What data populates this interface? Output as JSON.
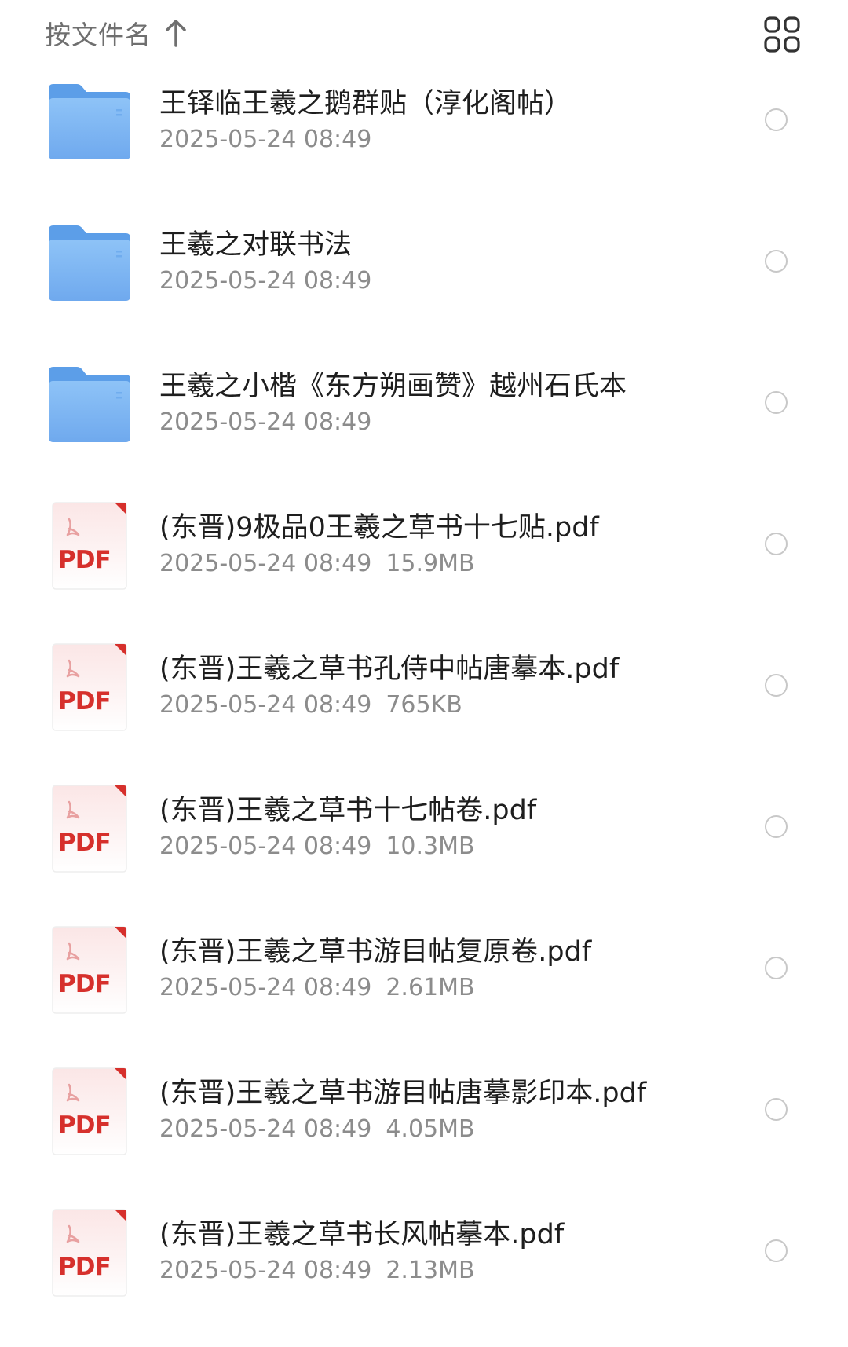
{
  "header": {
    "sort_label": "按文件名",
    "sort_icon": "arrow-up-icon",
    "view_icon": "grid-view-icon"
  },
  "files": [
    {
      "type": "folder",
      "name": "王铎临王羲之鹅群贴（淳化阁帖）",
      "date": "2025-05-24 08:49",
      "size": ""
    },
    {
      "type": "folder",
      "name": "王羲之对联书法",
      "date": "2025-05-24 08:49",
      "size": ""
    },
    {
      "type": "folder",
      "name": "王羲之小楷《东方朔画赞》越州石氏本",
      "date": "2025-05-24 08:49",
      "size": ""
    },
    {
      "type": "pdf",
      "name": "(东晋)9极品0王羲之草书十七贴.pdf",
      "date": "2025-05-24 08:49",
      "size": "15.9MB"
    },
    {
      "type": "pdf",
      "name": "(东晋)王羲之草书孔侍中帖唐摹本.pdf",
      "date": "2025-05-24 08:49",
      "size": "765KB"
    },
    {
      "type": "pdf",
      "name": "(东晋)王羲之草书十七帖卷.pdf",
      "date": "2025-05-24 08:49",
      "size": "10.3MB"
    },
    {
      "type": "pdf",
      "name": "(东晋)王羲之草书游目帖复原卷.pdf",
      "date": "2025-05-24 08:49",
      "size": "2.61MB"
    },
    {
      "type": "pdf",
      "name": "(东晋)王羲之草书游目帖唐摹影印本.pdf",
      "date": "2025-05-24 08:49",
      "size": "4.05MB"
    },
    {
      "type": "pdf",
      "name": "(东晋)王羲之草书长风帖摹本.pdf",
      "date": "2025-05-24 08:49",
      "size": "2.13MB"
    }
  ],
  "pdf_icon_label": "PDF",
  "colors": {
    "folder": "#7fb8f5",
    "pdf_red": "#d6302c",
    "text": "#1e1e1e",
    "meta": "#8c8c8c"
  }
}
